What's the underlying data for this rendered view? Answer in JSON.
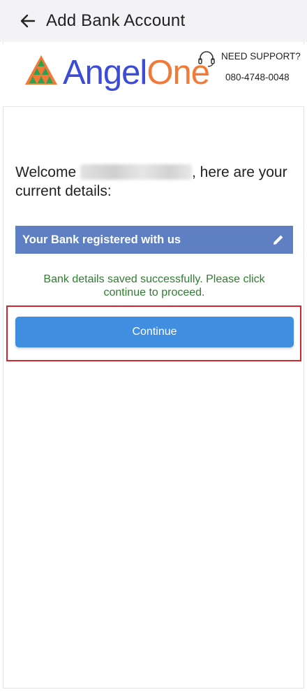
{
  "appbar": {
    "title": "Add Bank Account",
    "back_icon": "arrow-left-icon"
  },
  "brand": {
    "logo_part1": "Angel",
    "logo_part2": "One",
    "support_label": "NEED SUPPORT?",
    "support_phone": "080-4748-0048",
    "support_icon": "headset-icon",
    "colors": {
      "angel_blue": "#3d4cd6",
      "one_orange": "#f27a36"
    }
  },
  "welcome": {
    "prefix": "Welcome ",
    "suffix": ", here are your current details:"
  },
  "bank_section": {
    "label": "Your Bank registered with us",
    "edit_icon": "pencil-icon",
    "bar_color": "#5f7fc3"
  },
  "status": {
    "message": "Bank details saved successfully. Please click continue to proceed.",
    "color": "#2f7d2f"
  },
  "actions": {
    "continue_label": "Continue",
    "button_color": "#3f8ee0",
    "highlight_color": "#d0262f"
  }
}
